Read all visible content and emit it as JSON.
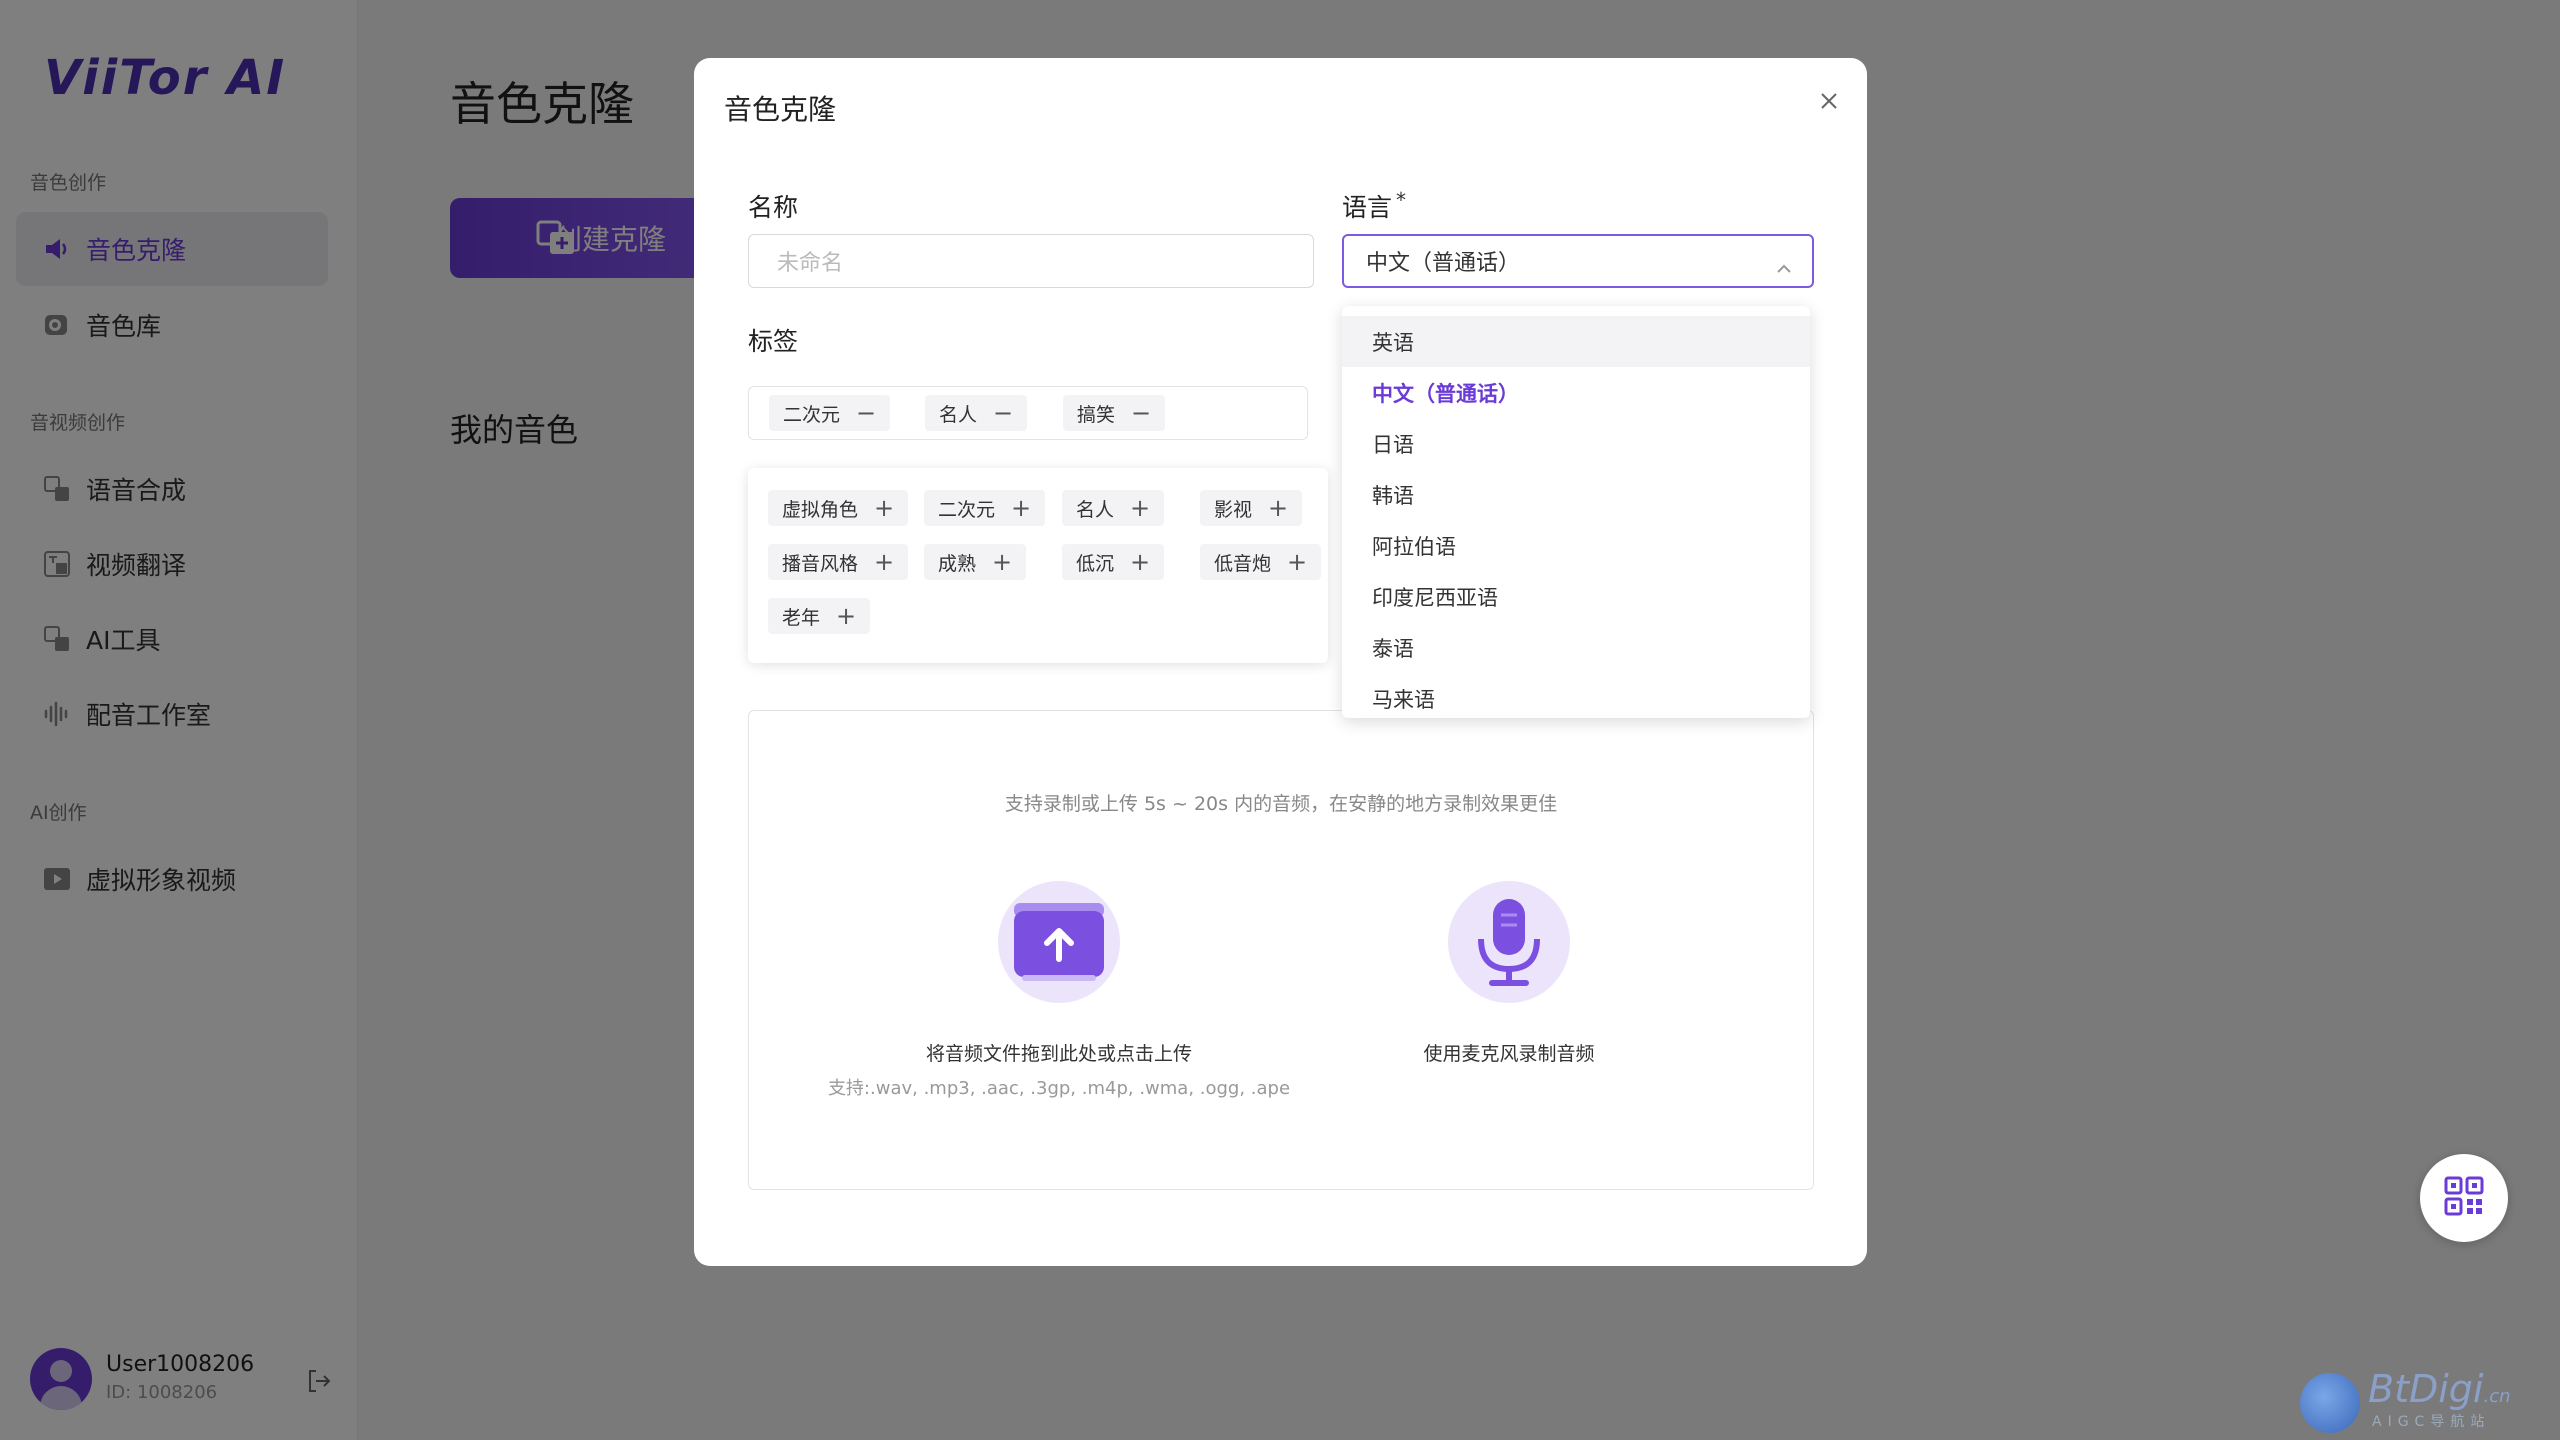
{
  "app": {
    "logo": "ViiTor AI"
  },
  "sidebar": {
    "sections": [
      {
        "label": "音色创作"
      },
      {
        "label": "音视频创作"
      },
      {
        "label": "AI创作"
      }
    ],
    "items": [
      {
        "label": "音色克隆",
        "icon": "speaker-icon"
      },
      {
        "label": "音色库",
        "icon": "library-icon"
      },
      {
        "label": "语音合成",
        "icon": "tts-icon"
      },
      {
        "label": "视频翻译",
        "icon": "translate-icon"
      },
      {
        "label": "AI工具",
        "icon": "ai-tool-icon"
      },
      {
        "label": "配音工作室",
        "icon": "waveform-icon"
      },
      {
        "label": "虚拟形象视频",
        "icon": "video-icon"
      }
    ],
    "user": {
      "name": "User1008206",
      "id": "ID: 1008206"
    }
  },
  "main": {
    "title": "音色克隆",
    "create_button": "创建克隆",
    "my_voices": "我的音色"
  },
  "modal": {
    "title": "音色克隆",
    "name_label": "名称",
    "name_placeholder": "未命名",
    "language_label": "语言",
    "language_required": "*",
    "language_value": "中文（普通话）",
    "tags_label": "标签",
    "selected_tags": [
      "二次元",
      "名人",
      "搞笑"
    ],
    "available_tags": [
      "虚拟角色",
      "二次元",
      "名人",
      "影视",
      "播音风格",
      "成熟",
      "低沉",
      "低音炮",
      "老年"
    ],
    "upload_hint": "支持录制或上传 5s ~ 20s 内的音频，在安静的地方录制效果更佳",
    "upload_text": "将音频文件拖到此处或点击上传",
    "upload_formats": "支持:.wav, .mp3, .aac, .3gp, .m4p, .wma, .ogg, .ape",
    "record_text": "使用麦克风录制音频"
  },
  "dropdown": {
    "options": [
      "英语",
      "中文（普通话）",
      "日语",
      "韩语",
      "阿拉伯语",
      "印度尼西亚语",
      "泰语",
      "马来语"
    ],
    "selected_index": 1,
    "hover_index": 0
  },
  "watermark": {
    "text": "BtDigi",
    "suffix": ".cn",
    "sub": "AIGC导航站"
  },
  "colors": {
    "accent": "#6a3bd6",
    "overlay": "rgba(0,0,0,0.5)"
  }
}
